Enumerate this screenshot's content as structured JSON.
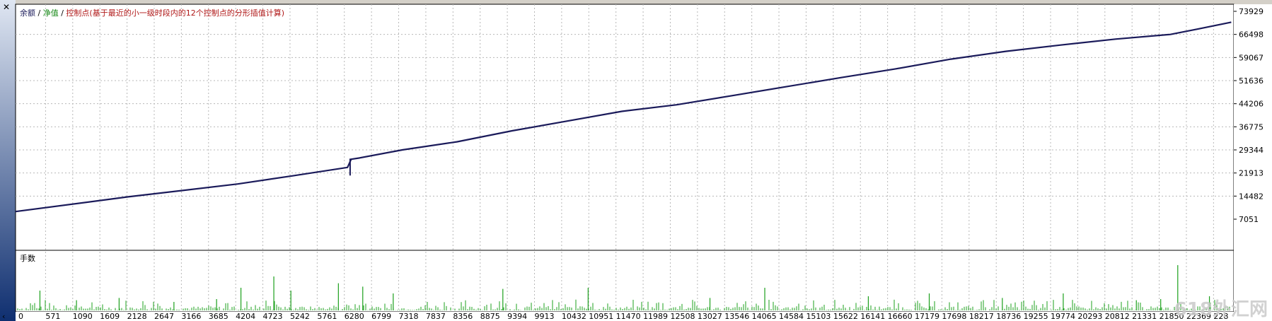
{
  "window": {
    "close_glyph": "✕",
    "collapse_glyph": "‹"
  },
  "legend": {
    "balance_label": "余额",
    "separator": " / ",
    "equity_label": "净值",
    "control_points_label": "控制点(基于最近的小一级时段内的12个控制点的分形插值计算)",
    "balance_color": "#1a1a5a",
    "equity_color": "#1a8a1a",
    "control_color": "#b01818"
  },
  "lots_panel": {
    "label": "手数",
    "bar_color": "#1ca01c"
  },
  "watermark": "618外汇网",
  "chart_data": [
    {
      "type": "line",
      "title": "",
      "x": [
        0,
        2128,
        4204,
        5242,
        6280,
        6350,
        6500,
        7318,
        8356,
        9394,
        10432,
        11470,
        12508,
        13546,
        14584,
        15622,
        16660,
        17698,
        18736,
        19774,
        20812,
        21850,
        22369,
        23000
      ],
      "series": [
        {
          "name": "余额",
          "values": [
            9500,
            14200,
            18300,
            20900,
            23600,
            26200,
            26600,
            29200,
            31800,
            35300,
            38400,
            41500,
            43600,
            46500,
            49400,
            52300,
            55100,
            58200,
            60700,
            62700,
            64600,
            66100,
            67800,
            70000
          ]
        },
        {
          "name": "净值",
          "values": [
            9500,
            14200,
            18300,
            20900,
            23600,
            26200,
            26600,
            29200,
            31800,
            35300,
            38400,
            41500,
            43600,
            46500,
            49400,
            52300,
            55100,
            58200,
            60700,
            62700,
            64600,
            66100,
            67800,
            70000
          ]
        }
      ],
      "ylim": [
        7051,
        73929
      ],
      "yticks": [
        "73929",
        "66498",
        "59067",
        "51636",
        "44206",
        "36775",
        "29344",
        "21913",
        "14482",
        "7051"
      ],
      "xticks": [
        "0",
        "571",
        "1090",
        "1609",
        "2128",
        "2647",
        "3166",
        "3685",
        "4204",
        "4723",
        "5242",
        "5761",
        "6280",
        "6799",
        "7318",
        "7837",
        "8356",
        "8875",
        "9394",
        "9913",
        "10432",
        "10951",
        "11470",
        "11989",
        "12508",
        "13027",
        "13546",
        "14065",
        "14584",
        "15103",
        "15622",
        "16141",
        "16660",
        "17179",
        "17698",
        "18217",
        "18736",
        "19255",
        "19774",
        "20293",
        "20812",
        "21331",
        "21850",
        "22369",
        "228"
      ],
      "grid": true
    },
    {
      "type": "bar",
      "title": "",
      "spikes": [
        {
          "x": 0.02,
          "v": 0.35
        },
        {
          "x": 0.05,
          "v": 0.18
        },
        {
          "x": 0.085,
          "v": 0.22
        },
        {
          "x": 0.13,
          "v": 0.15
        },
        {
          "x": 0.165,
          "v": 0.2
        },
        {
          "x": 0.185,
          "v": 0.4
        },
        {
          "x": 0.212,
          "v": 0.6
        },
        {
          "x": 0.226,
          "v": 0.35
        },
        {
          "x": 0.265,
          "v": 0.48
        },
        {
          "x": 0.285,
          "v": 0.42
        },
        {
          "x": 0.31,
          "v": 0.3
        },
        {
          "x": 0.4,
          "v": 0.38
        },
        {
          "x": 0.47,
          "v": 0.4
        },
        {
          "x": 0.57,
          "v": 0.22
        },
        {
          "x": 0.615,
          "v": 0.4
        },
        {
          "x": 0.7,
          "v": 0.25
        },
        {
          "x": 0.75,
          "v": 0.3
        },
        {
          "x": 0.81,
          "v": 0.22
        },
        {
          "x": 0.86,
          "v": 0.3
        },
        {
          "x": 0.92,
          "v": 0.18
        },
        {
          "x": 0.94,
          "v": 0.2
        },
        {
          "x": 0.954,
          "v": 0.8
        },
        {
          "x": 0.98,
          "v": 0.25
        }
      ],
      "noise_level": 0.12
    }
  ]
}
